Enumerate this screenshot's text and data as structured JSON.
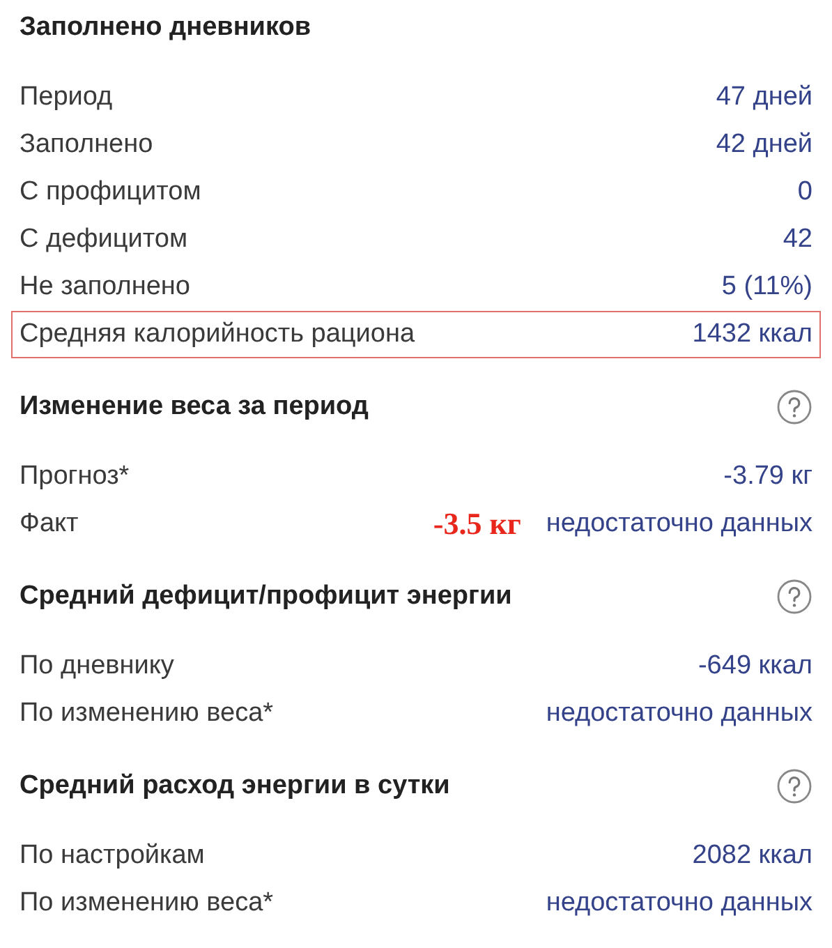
{
  "sections": [
    {
      "title": "Заполнено дневников",
      "help_icon": false,
      "rows": [
        {
          "label": "Период",
          "value": "47 дней",
          "highlighted": false
        },
        {
          "label": "Заполнено",
          "value": "42 дней",
          "highlighted": false
        },
        {
          "label": "С профицитом",
          "value": "0",
          "highlighted": false
        },
        {
          "label": "С дефицитом",
          "value": "42",
          "highlighted": false
        },
        {
          "label": "Не заполнено",
          "value": "5 (11%)",
          "highlighted": false
        },
        {
          "label": "Средняя калорийность рациона",
          "value": "1432 ккал",
          "highlighted": true
        }
      ]
    },
    {
      "title": "Изменение веса за период",
      "help_icon": true,
      "rows": [
        {
          "label": "Прогноз*",
          "value": "-3.79 кг",
          "highlighted": false
        },
        {
          "label": "Факт",
          "value": "недостаточно данных",
          "highlighted": false,
          "annotation": "-3.5 кг"
        }
      ]
    },
    {
      "title": "Средний дефицит/профицит энергии",
      "help_icon": true,
      "rows": [
        {
          "label": "По дневнику",
          "value": "-649 ккал",
          "highlighted": false
        },
        {
          "label": "По изменению веса*",
          "value": "недостаточно данных",
          "highlighted": false
        }
      ]
    },
    {
      "title": "Средний расход энергии в сутки",
      "help_icon": true,
      "rows": [
        {
          "label": "По настройкам",
          "value": "2082 ккал",
          "highlighted": false
        },
        {
          "label": "По изменению веса*",
          "value": "недостаточно данных",
          "highlighted": false
        }
      ]
    }
  ]
}
